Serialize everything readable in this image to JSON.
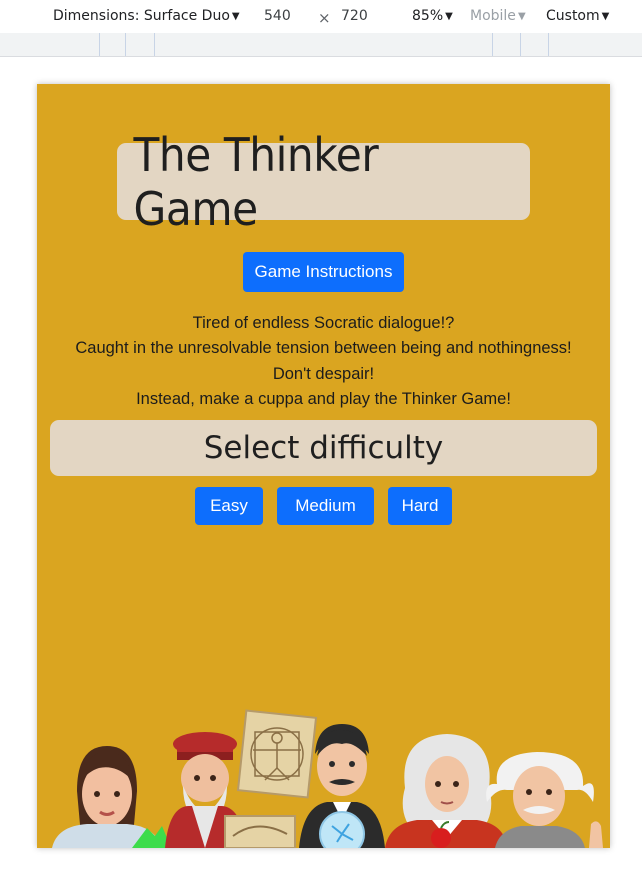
{
  "devtools": {
    "dimensions_label": "Dimensions: Surface Duo",
    "width": "540",
    "times": "×",
    "height": "720",
    "zoom": "85%",
    "throttle": "Mobile",
    "custom": "Custom"
  },
  "page": {
    "title": "The Thinker Game",
    "instructions_button": "Game Instructions",
    "intro_lines": [
      "Tired of endless Socratic dialogue!?",
      "Caught in the unresolvable tension between being and nothingness!",
      "Don't despair!",
      "Instead, make a cuppa and play the Thinker Game!"
    ],
    "difficulty_heading": "Select difficulty",
    "difficulty_buttons": {
      "easy": "Easy",
      "medium": "Medium",
      "hard": "Hard"
    }
  },
  "colors": {
    "background": "#daa520",
    "panel": "#e3d6c3",
    "button": "#0d6efd"
  },
  "illustration": {
    "icon": "famous-thinkers-illustration"
  }
}
